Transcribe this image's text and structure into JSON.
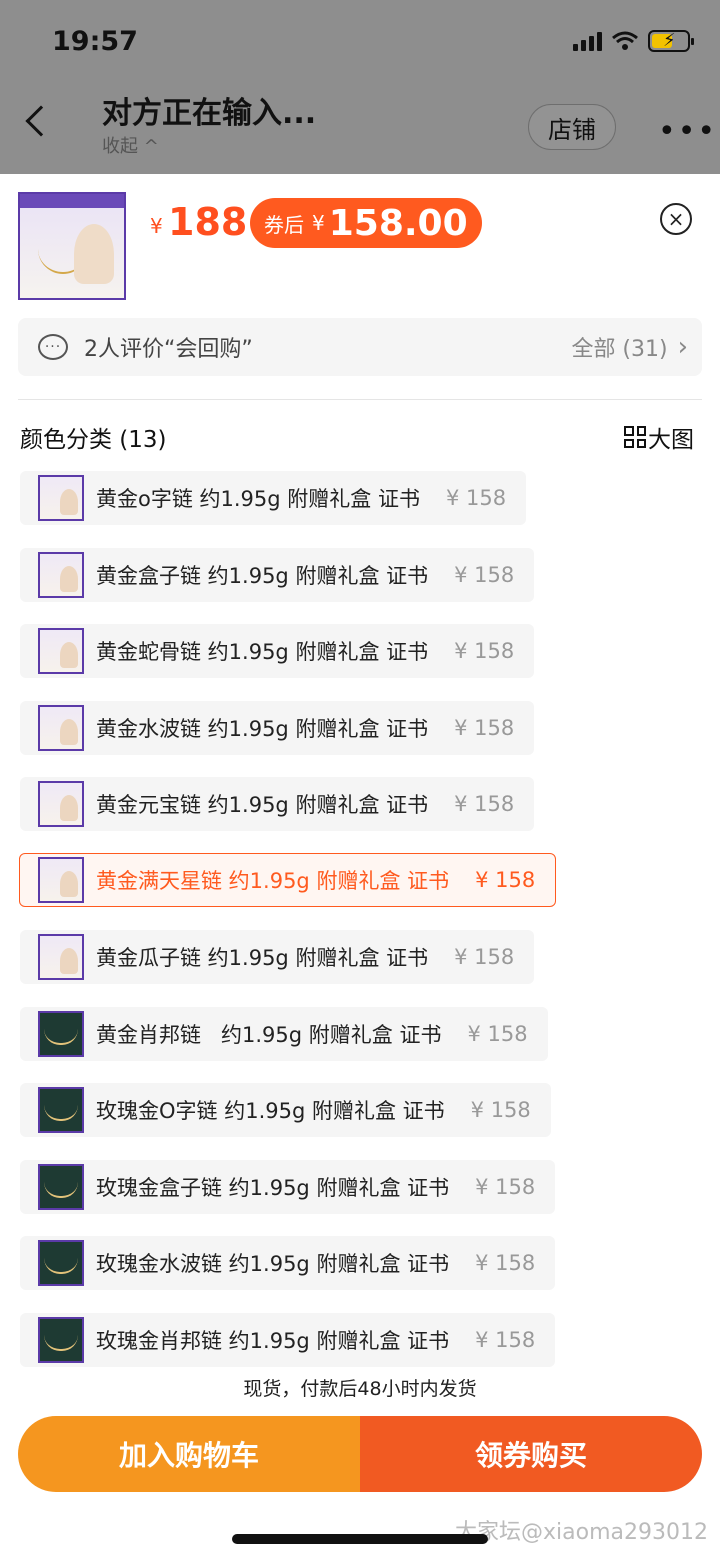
{
  "status_bar": {
    "time": "19:57"
  },
  "header": {
    "title": "对方正在输入...",
    "collapse_label": "收起 ^",
    "shop_label": "店铺",
    "more_label": "•••"
  },
  "product": {
    "price_yen": "¥",
    "price": "188",
    "coupon_label": "券后",
    "coupon_yen": "¥",
    "coupon_price": "158.00",
    "close_symbol": "×"
  },
  "reviews": {
    "text": "2人评价“会回购”",
    "all_label": "全部 (31)",
    "chevron": "›",
    "bubble": "···"
  },
  "variants": {
    "title": "颜色分类 (13)",
    "big_image_label": "大图",
    "items": [
      {
        "name": "黄金o字链 约1.95g 附赠礼盒 证书",
        "price": "¥ 158"
      },
      {
        "name": "黄金盒子链 约1.95g 附赠礼盒 证书",
        "price": "¥ 158"
      },
      {
        "name": "黄金蛇骨链 约1.95g 附赠礼盒 证书",
        "price": "¥ 158"
      },
      {
        "name": "黄金水波链 约1.95g 附赠礼盒 证书",
        "price": "¥ 158"
      },
      {
        "name": "黄金元宝链 约1.95g 附赠礼盒 证书",
        "price": "¥ 158"
      },
      {
        "name": "黄金满天星链 约1.95g 附赠礼盒 证书",
        "price": "¥ 158"
      },
      {
        "name": "黄金瓜子链 约1.95g 附赠礼盒 证书",
        "price": "¥ 158"
      },
      {
        "name": "黄金肖邦链   约1.95g 附赠礼盒 证书",
        "price": "¥ 158"
      },
      {
        "name": "玫瑰金O字链 约1.95g 附赠礼盒 证书",
        "price": "¥ 158"
      },
      {
        "name": "玫瑰金盒子链 约1.95g 附赠礼盒 证书",
        "price": "¥ 158"
      },
      {
        "name": "玫瑰金水波链 约1.95g 附赠礼盒 证书",
        "price": "¥ 158"
      },
      {
        "name": "玫瑰金肖邦链 约1.95g 附赠礼盒 证书",
        "price": "¥ 158"
      }
    ],
    "selected_index": 5
  },
  "shipping_note": "现货，付款后48小时内发货",
  "actions": {
    "add_to_cart": "加入购物车",
    "buy_with_coupon": "领券购买"
  },
  "watermark": "大家坛@xiaoma293012",
  "colors": {
    "accent": "#ff5a1f",
    "cart": "#f5961f",
    "buy": "#f15a22"
  }
}
